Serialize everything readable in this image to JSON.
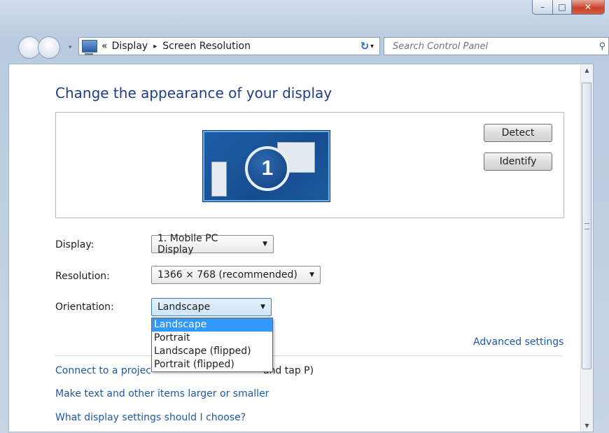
{
  "window": {
    "minimize_glyph": "–",
    "maximize_glyph": "□",
    "close_glyph": "✕"
  },
  "navbar": {
    "breadcrumb_prefix": "«",
    "breadcrumb": [
      "Display",
      "Screen Resolution"
    ],
    "breadcrumb_separator": "▸",
    "address_dropdown": "▾",
    "refresh_glyph": "↻",
    "search_placeholder": "Search Control Panel",
    "search_glyph": "⚲",
    "icons": [
      "back-icon",
      "forward-icon",
      "control-panel-icon",
      "refresh-icon",
      "search-icon"
    ]
  },
  "main": {
    "heading": "Change the appearance of your display",
    "monitor_number": "1",
    "detect_label": "Detect",
    "identify_label": "Identify",
    "display_label": "Display:",
    "display_value": "1. Mobile PC Display",
    "resolution_label": "Resolution:",
    "resolution_value": "1366 × 768 (recommended)",
    "orientation_label": "Orientation:",
    "orientation_value": "Landscape",
    "orientation_options": [
      "Landscape",
      "Portrait",
      "Landscape (flipped)",
      "Portrait (flipped)"
    ],
    "advanced_settings": "Advanced settings",
    "link_projector_left": "Connect to a projec",
    "link_projector_right": "and tap P)",
    "link_text_size": "Make text and other items larger or smaller",
    "link_which_settings": "What display settings should I choose?"
  },
  "colors": {
    "link": "#1e59a8",
    "heading": "#1e3f85",
    "selection": "#3399ff"
  }
}
